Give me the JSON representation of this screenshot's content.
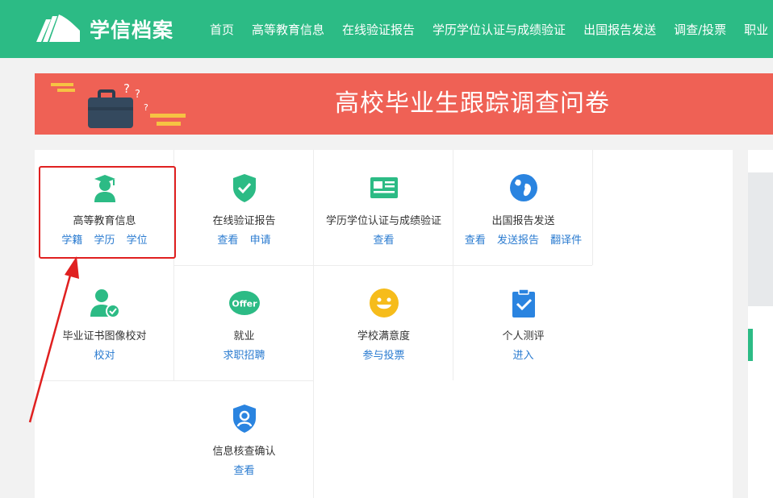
{
  "header": {
    "logo_text": "学信档案",
    "nav": [
      "首页",
      "高等教育信息",
      "在线验证报告",
      "学历学位认证与成绩验证",
      "出国报告发送",
      "调查/投票",
      "职业"
    ]
  },
  "banner": {
    "title": "高校毕业生跟踪调查问卷"
  },
  "services": [
    {
      "title": "高等教育信息",
      "links": [
        "学籍",
        "学历",
        "学位"
      ],
      "icon": "graduate-icon"
    },
    {
      "title": "在线验证报告",
      "links": [
        "查看",
        "申请"
      ],
      "icon": "shield-check-icon"
    },
    {
      "title": "学历学位认证与成绩验证",
      "links": [
        "查看"
      ],
      "icon": "id-card-icon"
    },
    {
      "title": "出国报告发送",
      "links": [
        "查看",
        "发送报告",
        "翻译件"
      ],
      "icon": "globe-icon"
    },
    {
      "title": "毕业证书图像校对",
      "links": [
        "校对"
      ],
      "icon": "user-check-icon"
    },
    {
      "title": "就业",
      "links": [
        "求职招聘"
      ],
      "icon": "offer-icon",
      "icon_text": "Offer"
    },
    {
      "title": "学校满意度",
      "links": [
        "参与投票"
      ],
      "icon": "smiley-icon"
    },
    {
      "title": "个人测评",
      "links": [
        "进入"
      ],
      "icon": "clipboard-check-icon"
    },
    {
      "title": "信息核查确认",
      "links": [
        "查看"
      ],
      "icon": "shield-user-icon"
    }
  ],
  "colors": {
    "brand": "#2cbb85",
    "banner": "#ef6155",
    "link": "#2a7bd0",
    "highlight": "#e02020"
  }
}
